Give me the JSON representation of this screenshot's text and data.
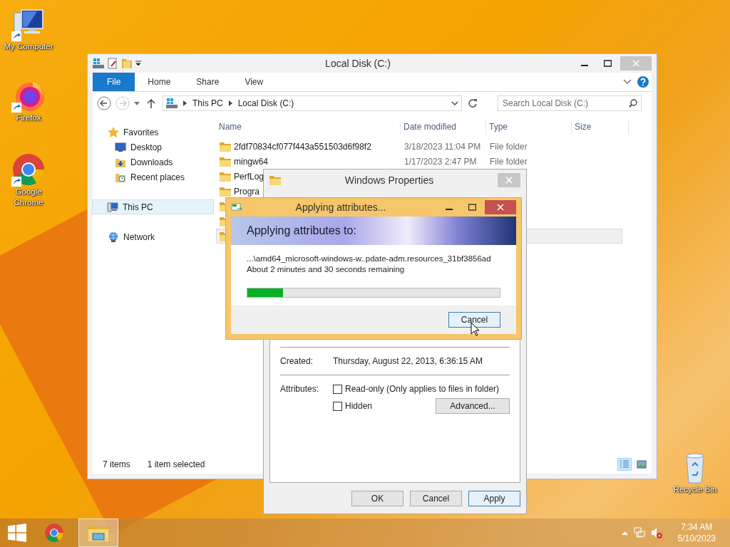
{
  "desktop": {
    "icons": [
      {
        "label": "My Computer",
        "kind": "computer"
      },
      {
        "label": "Firefox",
        "kind": "firefox"
      },
      {
        "label": "Google Chrome",
        "kind": "chrome"
      }
    ],
    "recycle_bin": {
      "label": "Recycle Bin"
    }
  },
  "explorer": {
    "title": "Local Disk (C:)",
    "ribbon_tabs": [
      {
        "label": "File",
        "selected": true
      },
      {
        "label": "Home",
        "selected": false
      },
      {
        "label": "Share",
        "selected": false
      },
      {
        "label": "View",
        "selected": false
      }
    ],
    "breadcrumb": [
      "This PC",
      "Local Disk (C:)"
    ],
    "search": {
      "placeholder": "Search Local Disk (C:)"
    },
    "nav": [
      {
        "label": "Favorites",
        "kind": "star",
        "selected": false,
        "children": [
          {
            "label": "Desktop",
            "kind": "desktop",
            "selected": false
          },
          {
            "label": "Downloads",
            "kind": "downloads",
            "selected": false
          },
          {
            "label": "Recent places",
            "kind": "recent",
            "selected": false
          }
        ]
      },
      {
        "label": "This PC",
        "kind": "pc",
        "selected": true
      },
      {
        "label": "Network",
        "kind": "network",
        "selected": false
      }
    ],
    "columns": [
      "Name",
      "Date modified",
      "Type",
      "Size"
    ],
    "rows": [
      {
        "name": "2fdf70834cf077f443a551503d6f98f2",
        "date": "3/18/2023 11:04 PM",
        "type": "File folder",
        "selected": false
      },
      {
        "name": "mingw64",
        "date": "1/17/2023 2:47 PM",
        "type": "File folder",
        "selected": false
      },
      {
        "name": "PerfLog",
        "selected": false
      },
      {
        "name": "Progra",
        "selected": false
      },
      {
        "selected": false
      },
      {
        "selected": false
      },
      {
        "selected": true
      }
    ],
    "status": {
      "count": "7 items",
      "selection": "1 item selected"
    },
    "views": [
      {
        "kind": "details",
        "selected": true
      },
      {
        "kind": "thumbnails",
        "selected": false
      }
    ]
  },
  "properties": {
    "title": "Windows Properties",
    "created_label": "Created:",
    "created_value": "Thursday, August 22, 2013, 6:36:15 AM",
    "attributes_label": "Attributes:",
    "checkboxes": [
      {
        "label": "Read-only (Only applies to files in folder)",
        "checked": false
      },
      {
        "label": "Hidden",
        "checked": false
      }
    ],
    "advanced_button": "Advanced...",
    "buttons": [
      {
        "label": "OK",
        "focused": false
      },
      {
        "label": "Cancel",
        "focused": false
      },
      {
        "label": "Apply",
        "focused": true
      }
    ]
  },
  "progress_dialog": {
    "title": "Applying attributes...",
    "heading": "Applying attributes to:",
    "path": "...\\amd64_microsoft-windows-w..pdate-adm.resources_31bf3856ad",
    "remaining": "About 2 minutes and 30 seconds remaining",
    "level": 0.14,
    "cancel_button": {
      "label": "Cancel",
      "focused": true
    }
  },
  "taskbar": {
    "apps": [
      {
        "kind": "chrome",
        "active": false
      },
      {
        "kind": "explorer",
        "active": true
      }
    ],
    "time": "7:34 AM",
    "date": "5/10/2023"
  }
}
